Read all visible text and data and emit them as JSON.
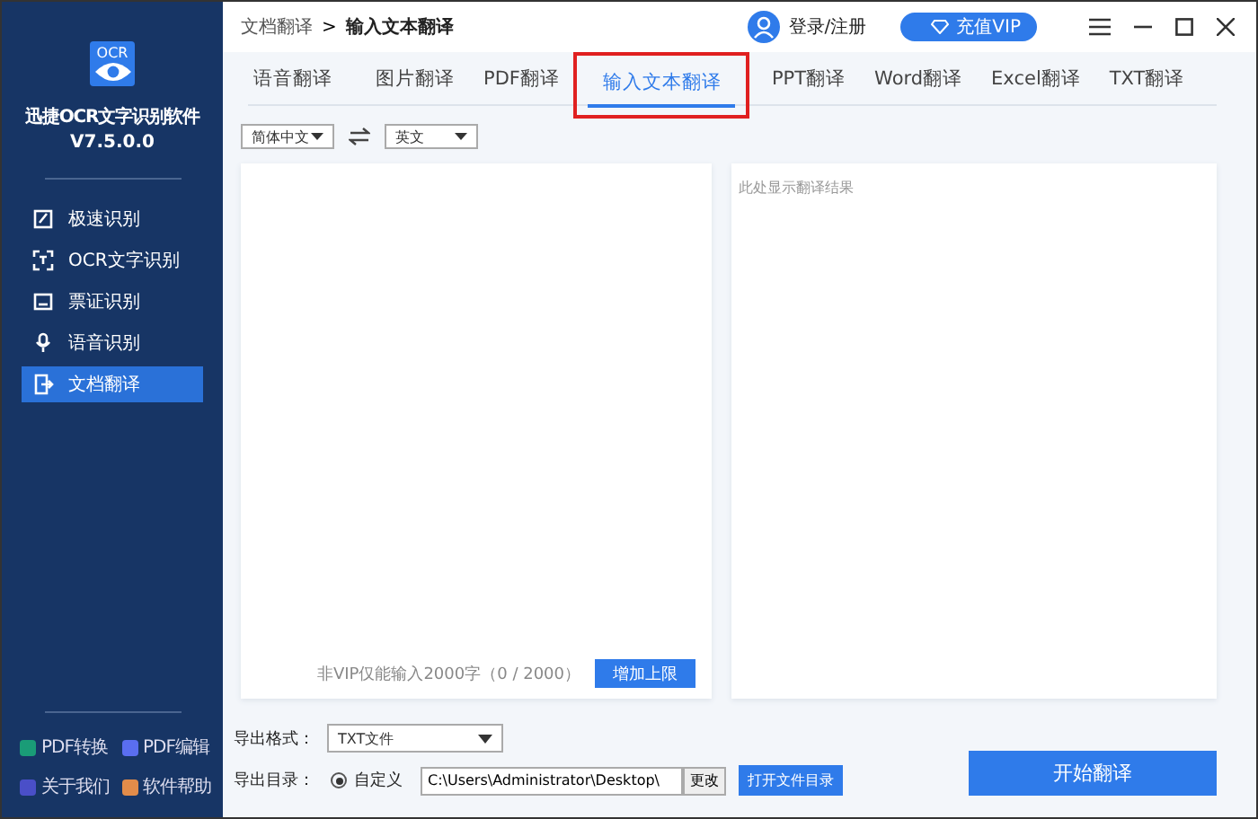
{
  "app": {
    "logo_text": "OCR",
    "name": "迅捷OCR文字识别软件",
    "version": "V7.5.0.0"
  },
  "nav": [
    {
      "label": "极速识别",
      "selected": false
    },
    {
      "label": "OCR文字识别",
      "selected": false
    },
    {
      "label": "票证识别",
      "selected": false
    },
    {
      "label": "语音识别",
      "selected": false
    },
    {
      "label": "文档翻译",
      "selected": true
    }
  ],
  "footer_links": [
    {
      "label": "PDF转换",
      "color": "#1a9c77"
    },
    {
      "label": "PDF编辑",
      "color": "#5a6ef0"
    },
    {
      "label": "关于我们",
      "color": "#4a4fc8"
    },
    {
      "label": "软件帮助",
      "color": "#e28c4a"
    }
  ],
  "breadcrumb": {
    "parent": "文档翻译",
    "separator": ">",
    "current": "输入文本翻译"
  },
  "account": {
    "login": "登录/注册",
    "vip": "充值VIP"
  },
  "tabs": [
    {
      "label": "语音翻译",
      "selected": false
    },
    {
      "label": "图片翻译",
      "selected": false
    },
    {
      "label": "PDF翻译",
      "selected": false
    },
    {
      "label": "输入文本翻译",
      "selected": true
    },
    {
      "label": "PPT翻译",
      "selected": false
    },
    {
      "label": "Word翻译",
      "selected": false
    },
    {
      "label": "Excel翻译",
      "selected": false
    },
    {
      "label": "TXT翻译",
      "selected": false
    }
  ],
  "source_lang": "简体中文",
  "target_lang": "英文",
  "input": {
    "limit_note": "非VIP仅能输入2000字（0 / 2000）",
    "raise_button": "增加上限"
  },
  "output": {
    "placeholder": "此处显示翻译结果"
  },
  "export": {
    "format_label": "导出格式：",
    "format": "TXT文件",
    "dir_label": "导出目录：",
    "radio": {
      "label": "自定义",
      "selected": true
    },
    "path": "C:\\Users\\Administrator\\Desktop\\",
    "change_button": "更改",
    "open_button": "打开文件目录",
    "start_button": "开始翻译"
  }
}
